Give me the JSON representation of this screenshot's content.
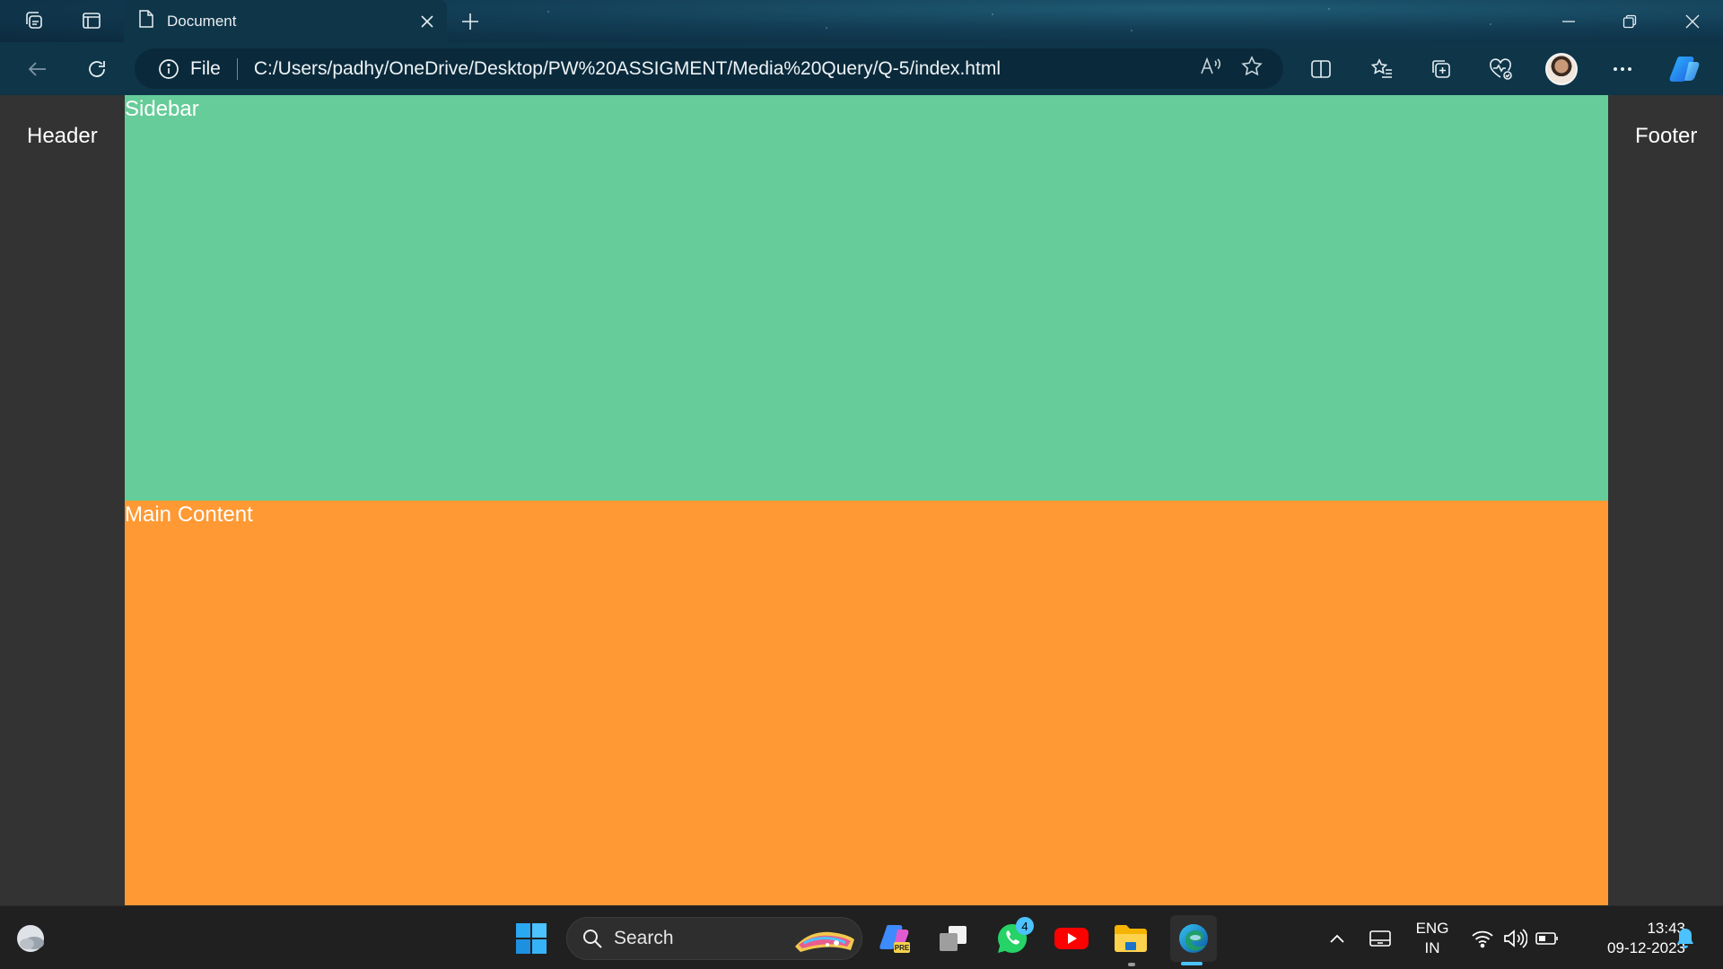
{
  "browser": {
    "tab": {
      "title": "Document"
    },
    "address": {
      "scheme_label": "File",
      "url": "C:/Users/padhy/OneDrive/Desktop/PW%20ASSIGMENT/Media%20Query/Q-5/index.html"
    }
  },
  "page": {
    "header_label": "Header",
    "sidebar_label": "Sidebar",
    "main_label": "Main Content",
    "footer_label": "Footer",
    "colors": {
      "background": "#333333",
      "sidebar": "#66cc99",
      "main": "#ff9933",
      "text": "#ffffff"
    }
  },
  "taskbar": {
    "search_label": "Search",
    "whatsapp_badge": "4",
    "language_top": "ENG",
    "language_bottom": "IN",
    "time": "13:43",
    "date": "09-12-2023",
    "pinned_icons": [
      "windows-start-icon",
      "copilot-pre-icon",
      "task-view-icon",
      "whatsapp-icon",
      "youtube-icon",
      "file-explorer-icon",
      "edge-icon"
    ],
    "tray_icons": [
      "chevron-up-icon",
      "tablet-icon",
      "wifi-icon",
      "volume-icon",
      "battery-icon",
      "notification-bell-icon"
    ]
  },
  "accent_color": "#4cc2ff"
}
